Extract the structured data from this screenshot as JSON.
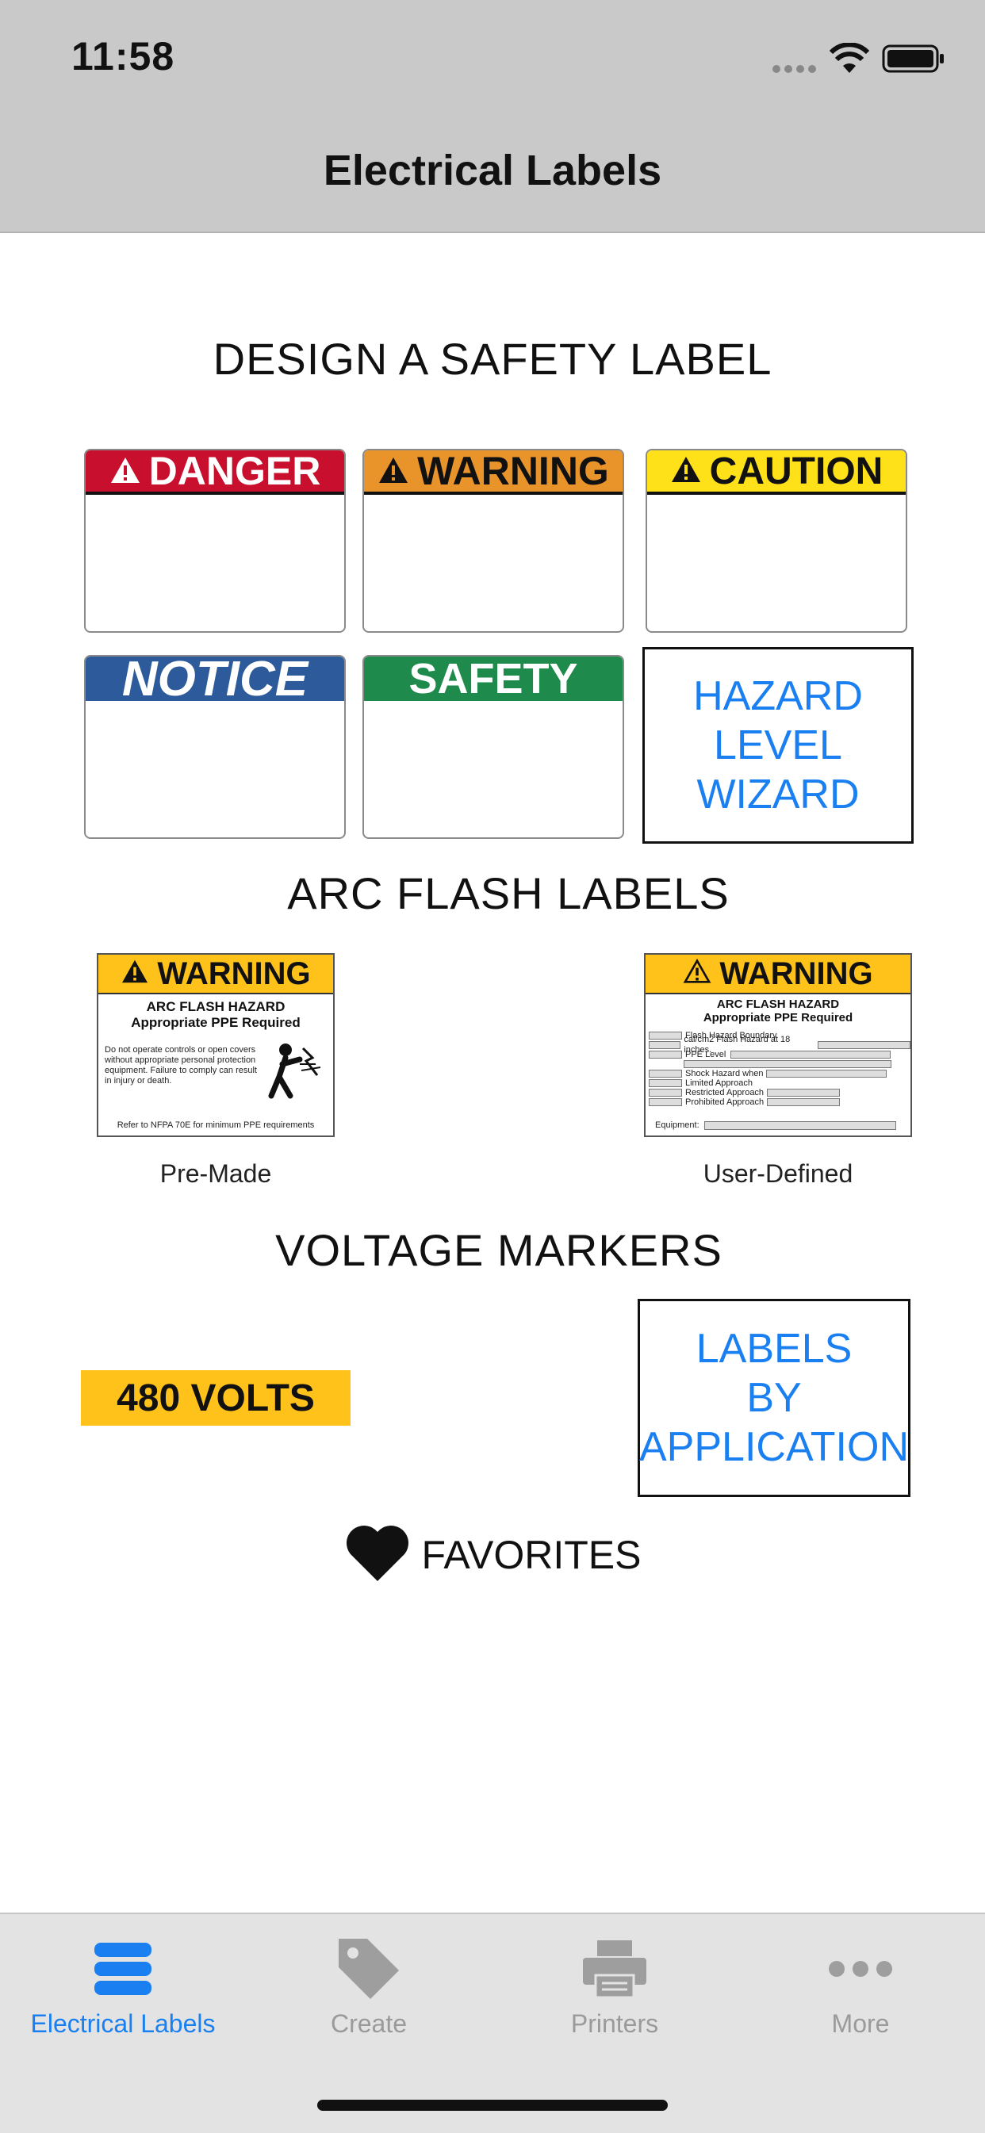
{
  "status_bar": {
    "time": "11:58"
  },
  "nav": {
    "title": "Electrical Labels"
  },
  "sections": {
    "design": "DESIGN A SAFETY LABEL",
    "arc": "ARC FLASH LABELS",
    "voltage": "VOLTAGE MARKERS"
  },
  "safety_labels": {
    "danger": "DANGER",
    "warning": "WARNING",
    "caution": "CAUTION",
    "notice": "NOTICE",
    "safety": "SAFETY",
    "wizard": [
      "HAZARD",
      "LEVEL",
      "WIZARD"
    ]
  },
  "arc_flash": {
    "premade": {
      "header": "WARNING",
      "sub1": "ARC FLASH HAZARD",
      "sub2": "Appropriate PPE Required",
      "body": "Do not operate controls or open covers without appropriate personal protection equipment. Failure to comply can result in injury or death.",
      "footer": "Refer to NFPA 70E for minimum PPE requirements",
      "caption": "Pre-Made"
    },
    "userdef": {
      "header": "WARNING",
      "sub1": "ARC FLASH HAZARD",
      "sub2": "Appropriate PPE Required",
      "rows": [
        "Flash Hazard Boundary",
        "cal/cm2 Flash Hazard at 18 inches.",
        "PPE Level",
        "Shock Hazard when",
        "Limited Approach",
        "Restricted Approach",
        "Prohibited Approach"
      ],
      "equipment": "Equipment:",
      "caption": "User-Defined"
    }
  },
  "voltage": {
    "marker": "480 VOLTS",
    "by_application": [
      "LABELS",
      "BY",
      "APPLICATION"
    ]
  },
  "favorites": {
    "label": "FAVORITES"
  },
  "tabs": [
    {
      "label": "Electrical Labels",
      "icon": "server-stack-icon",
      "active": true
    },
    {
      "label": "Create",
      "icon": "tag-icon",
      "active": false
    },
    {
      "label": "Printers",
      "icon": "printer-icon",
      "active": false
    },
    {
      "label": "More",
      "icon": "ellipsis-icon",
      "active": false
    }
  ],
  "colors": {
    "accent": "#1a7ff0",
    "danger": "#c8102e",
    "warning": "#e8942a",
    "caution": "#ffe11a",
    "notice": "#2c5a9a",
    "safety": "#1e8a4c",
    "arc_yellow": "#ffc21a"
  }
}
